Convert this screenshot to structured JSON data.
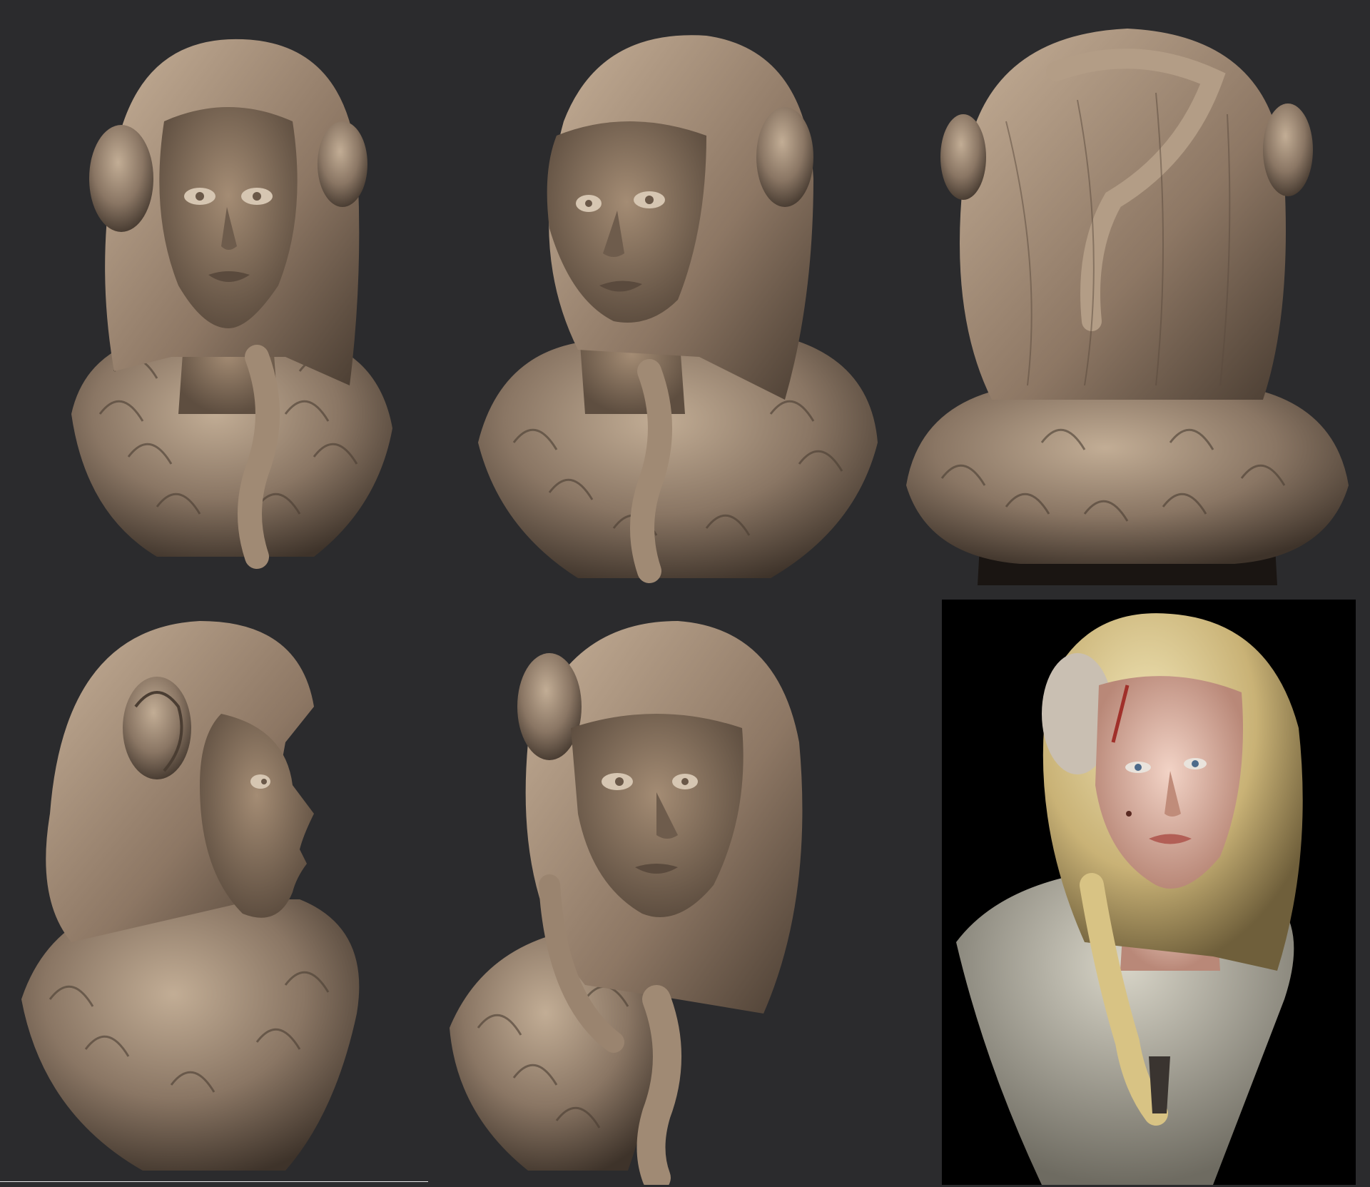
{
  "sheet": {
    "background": "#2b2b2d",
    "sculpt_color": "#8a7664",
    "sculpt_shadow": "#3e332a",
    "sculpt_highlight": "#c2ad95",
    "concept_background": "#000000"
  },
  "views": [
    {
      "name": "front",
      "row": 1,
      "col": 1
    },
    {
      "name": "three-quarter",
      "row": 1,
      "col": 2
    },
    {
      "name": "back",
      "row": 1,
      "col": 3
    },
    {
      "name": "side-profile",
      "row": 2,
      "col": 1
    },
    {
      "name": "three-quarter-low",
      "row": 2,
      "col": 2
    },
    {
      "name": "painted-concept",
      "row": 2,
      "col": 3
    }
  ],
  "concept_colors": {
    "hair": "#d9c48a",
    "skin": "#e8c2b3",
    "fur": "#b9b7a8",
    "scar": "#a0302a"
  }
}
